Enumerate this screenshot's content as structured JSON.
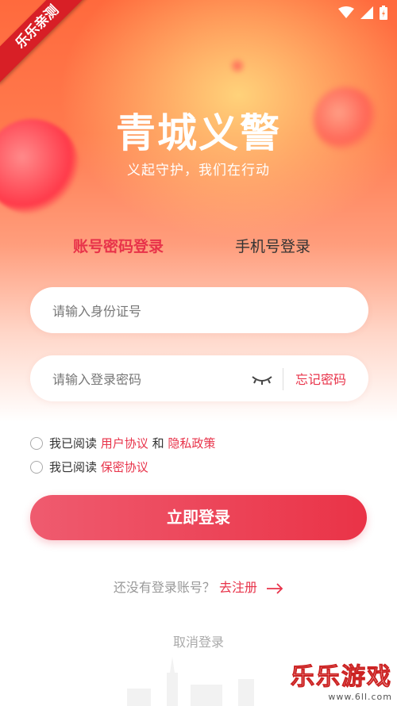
{
  "app": {
    "logo_text": "青城义警",
    "slogan": "义起守护，我们在行动"
  },
  "ribbon": {
    "text": "乐乐亲测"
  },
  "tabs": [
    {
      "label": "账号密码登录",
      "active": true
    },
    {
      "label": "手机号登录",
      "active": false
    }
  ],
  "form": {
    "id_placeholder": "请输入身份证号",
    "password_placeholder": "请输入登录密码",
    "forgot_password": "忘记密码"
  },
  "agreements": [
    {
      "prefix": "我已阅读",
      "link1": "用户协议",
      "joiner": "和",
      "link2": "隐私政策",
      "checked": false
    },
    {
      "prefix": "我已阅读",
      "link1": "保密协议",
      "checked": false
    }
  ],
  "login_button": "立即登录",
  "register": {
    "text": "还没有登录账号？",
    "link": "去注册"
  },
  "cancel": "取消登录",
  "watermark": {
    "main": "乐乐游戏",
    "sub": "www.6ll.com"
  },
  "colors": {
    "accent": "#e8334a",
    "gradient_top": "#ff6a3d"
  },
  "icons": [
    "wifi-icon",
    "signal-icon",
    "battery-icon",
    "eye-closed-icon",
    "arrow-right-icon"
  ]
}
